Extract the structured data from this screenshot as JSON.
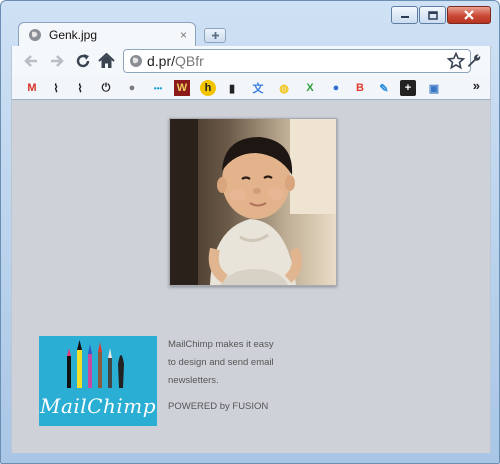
{
  "window": {
    "controls": {
      "minimize": "minimize-icon",
      "maximize": "maximize-icon",
      "close": "close-icon"
    }
  },
  "tab": {
    "title": "Genk.jpg",
    "close_glyph": "×",
    "new_tab_glyph": "+"
  },
  "omnibox": {
    "url_host": "d.pr/",
    "url_path": "QBfr"
  },
  "bookmarks": [
    {
      "name": "gmail",
      "color": "#d93025"
    },
    {
      "name": "activity-1",
      "color": "#222222"
    },
    {
      "name": "activity-2",
      "color": "#222222"
    },
    {
      "name": "power",
      "color": "#222222"
    },
    {
      "name": "globe",
      "color": "#7a7a7a"
    },
    {
      "name": "dots",
      "color": "#1aa0d8"
    },
    {
      "name": "w",
      "color": "#8b1a1a"
    },
    {
      "name": "h",
      "color": "#d8a400"
    },
    {
      "name": "books",
      "color": "#222222"
    },
    {
      "name": "translate",
      "color": "#3b7ddd"
    },
    {
      "name": "bulb",
      "color": "#f0c419"
    },
    {
      "name": "x",
      "color": "#2e9d3b"
    },
    {
      "name": "globe-blue",
      "color": "#2f6fd6"
    },
    {
      "name": "b",
      "color": "#e23b2e"
    },
    {
      "name": "pencil",
      "color": "#2b8ddb"
    },
    {
      "name": "plus",
      "color": "#222222"
    },
    {
      "name": "image",
      "color": "#3a78c5"
    }
  ],
  "bookmarks_overflow": "»",
  "content": {
    "mailchimp_wordmark": "MailChimp",
    "mailchimp_text": [
      "MailChimp makes it easy",
      "to design and send email",
      "newsletters."
    ],
    "powered_by": "POWERED by FUSION"
  },
  "colors": {
    "page_bg": "#ced2d8",
    "mailchimp_blue": "#2aaed4"
  }
}
